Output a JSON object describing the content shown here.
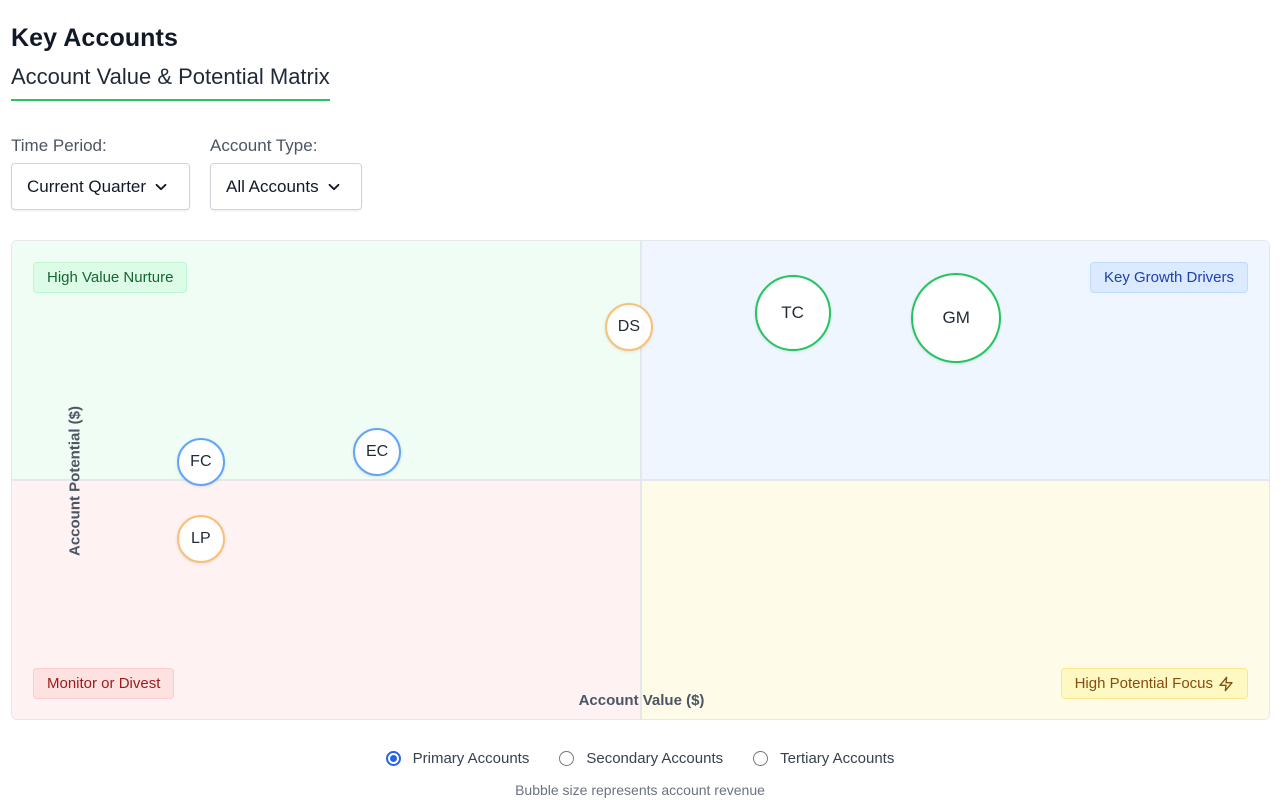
{
  "header": {
    "title": "Key Accounts",
    "subtitle": "Account Value & Potential Matrix"
  },
  "filters": {
    "time_period": {
      "label": "Time Period:",
      "value": "Current Quarter"
    },
    "account_type": {
      "label": "Account Type:",
      "value": "All Accounts"
    }
  },
  "matrix": {
    "quadrants": {
      "top_left": "High Value Nurture",
      "top_right": "Key Growth Drivers",
      "bottom_left": "Monitor or Divest",
      "bottom_right": "High Potential Focus"
    },
    "x_axis_label": "Account Value ($)",
    "y_axis_label": "Account Potential ($)",
    "colors": {
      "green": "#22c55e",
      "blue": "#60a5fa",
      "orange": "#fbbf77"
    },
    "accounts": [
      {
        "code": "FC",
        "tier": "blue",
        "value": 0.15,
        "potential": 0.54,
        "size": "sm"
      },
      {
        "code": "EC",
        "tier": "blue",
        "value": 0.29,
        "potential": 0.56,
        "size": "sm"
      },
      {
        "code": "DS",
        "tier": "orange",
        "value": 0.49,
        "potential": 0.82,
        "size": "sm"
      },
      {
        "code": "TC",
        "tier": "green",
        "value": 0.62,
        "potential": 0.85,
        "size": "md"
      },
      {
        "code": "GM",
        "tier": "green",
        "value": 0.75,
        "potential": 0.84,
        "size": "lg"
      },
      {
        "code": "LP",
        "tier": "orange",
        "value": 0.15,
        "potential": 0.38,
        "size": "sm"
      }
    ]
  },
  "legend": {
    "options": [
      {
        "label": "Primary Accounts",
        "checked": true
      },
      {
        "label": "Secondary Accounts",
        "checked": false
      },
      {
        "label": "Tertiary Accounts",
        "checked": false
      }
    ],
    "note": "Bubble size represents account revenue"
  }
}
